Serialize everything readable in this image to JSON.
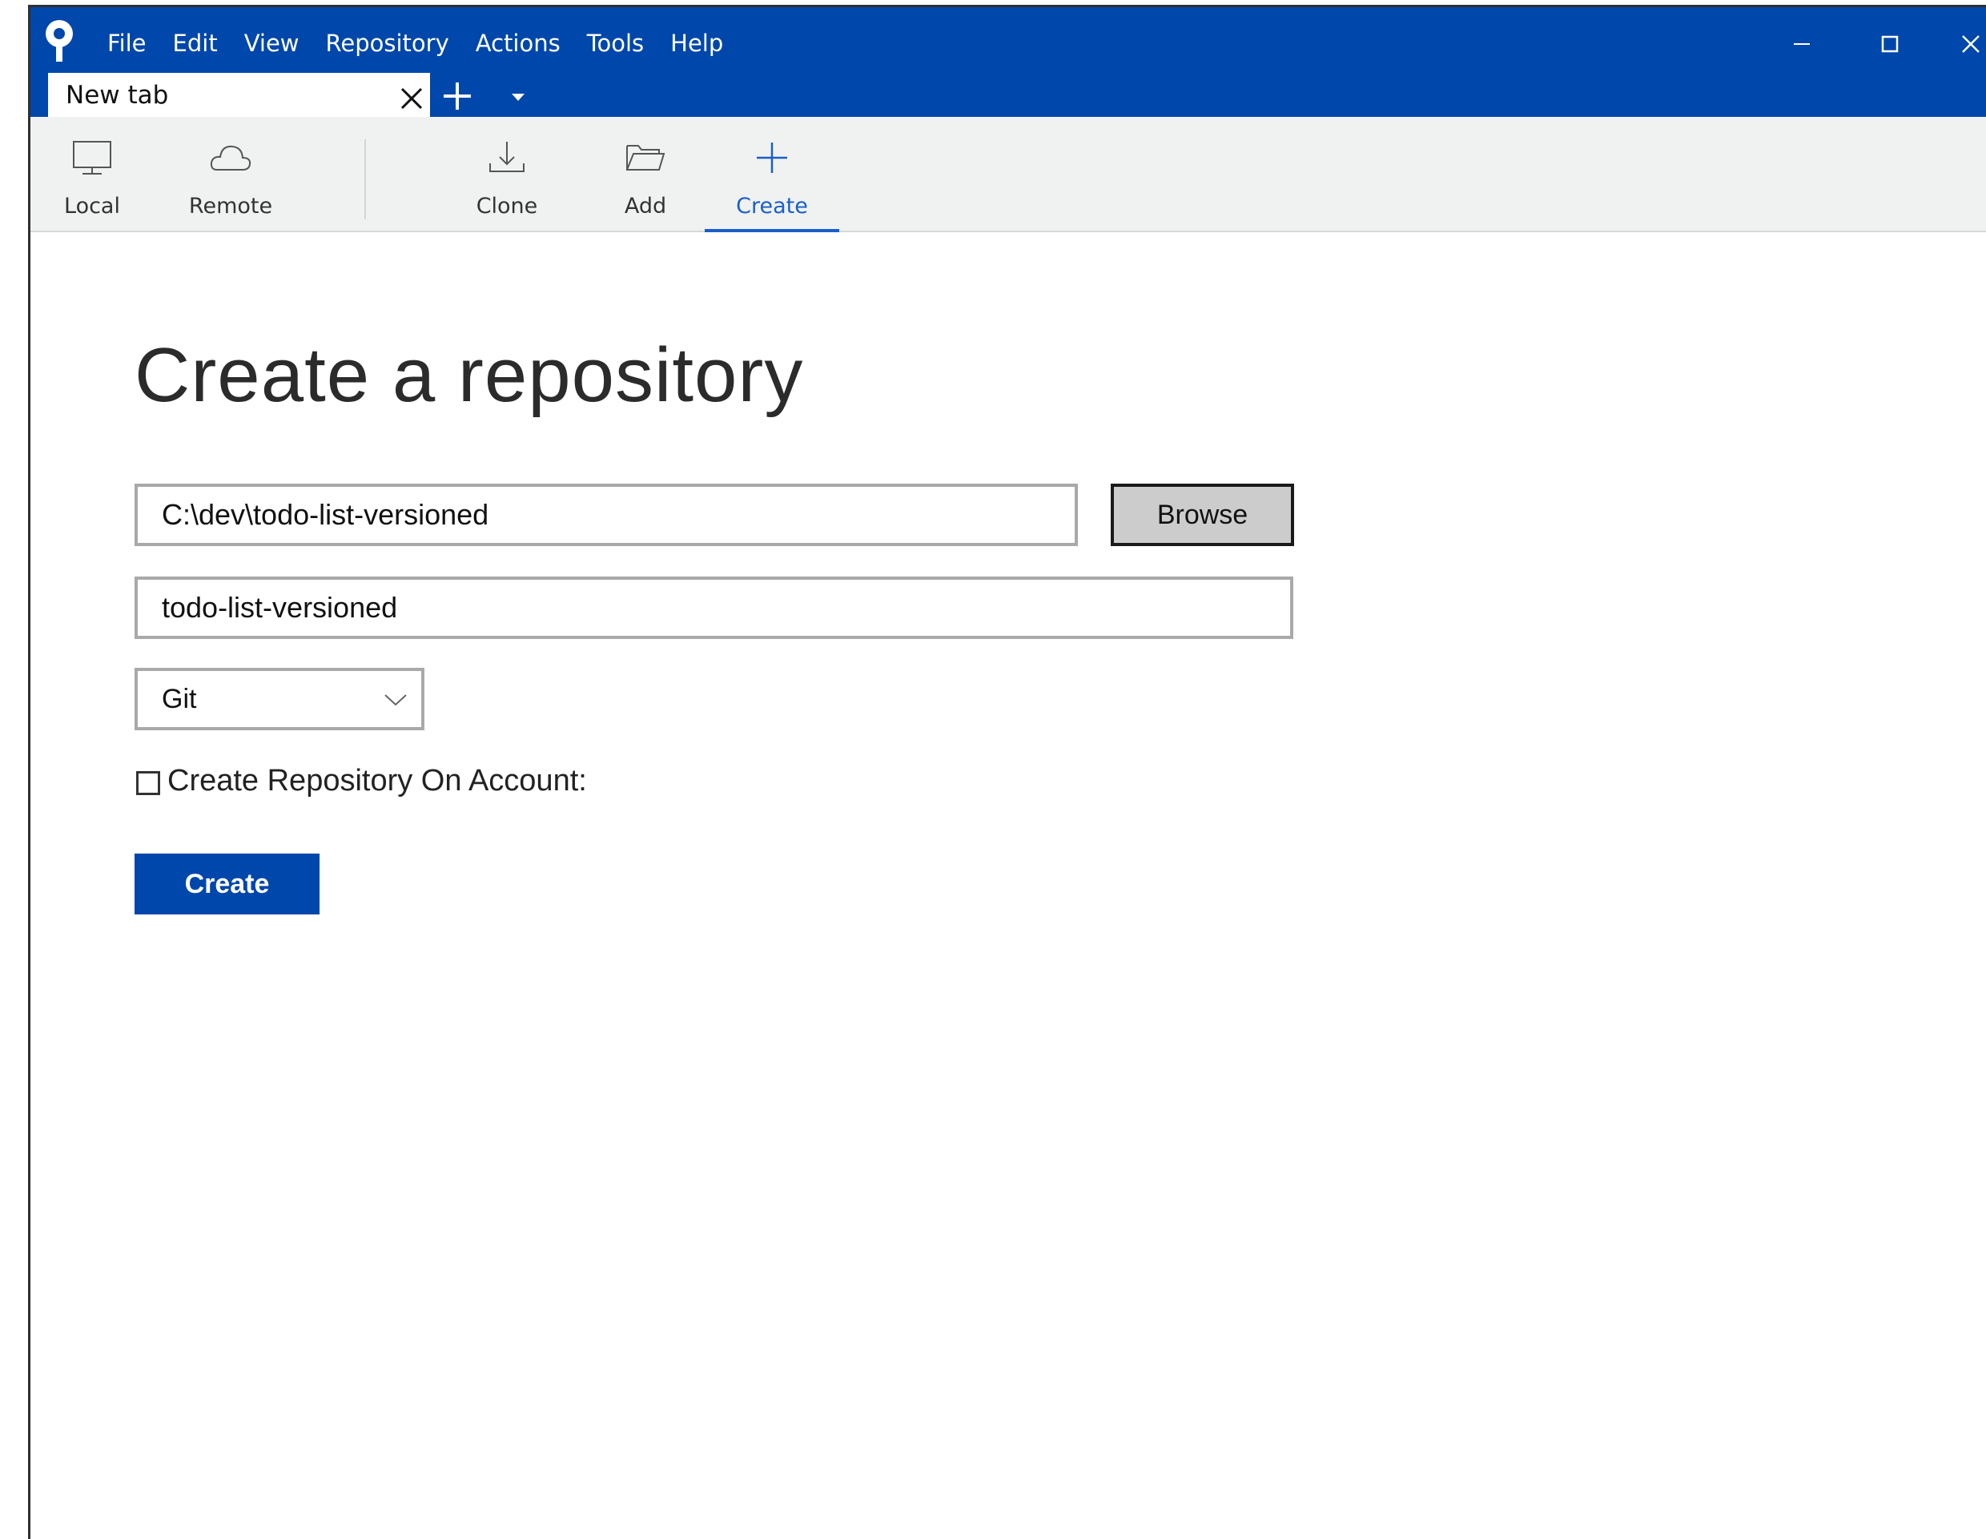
{
  "window": {
    "menu": [
      "File",
      "Edit",
      "View",
      "Repository",
      "Actions",
      "Tools",
      "Help"
    ],
    "tab_title": "New tab"
  },
  "toolbar": {
    "local": "Local",
    "remote": "Remote",
    "clone": "Clone",
    "add": "Add",
    "create": "Create",
    "active": "Create"
  },
  "main": {
    "title": "Create a repository",
    "path_value": "C:\\dev\\todo-list-versioned",
    "browse_label": "Browse",
    "name_value": "todo-list-versioned",
    "vcs_selected": "Git",
    "create_on_account_label": "Create Repository On Account:",
    "create_on_account_checked": false,
    "create_button_label": "Create"
  },
  "colors": {
    "brand": "#0047ab",
    "active_tab": "#1a5fc8"
  }
}
